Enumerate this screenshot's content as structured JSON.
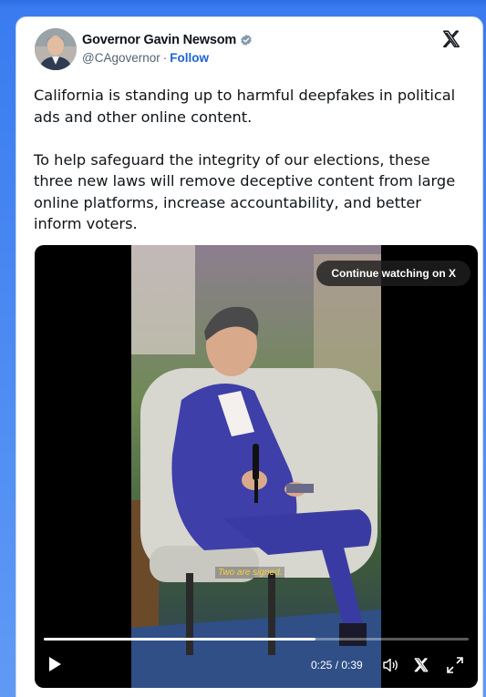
{
  "tweet": {
    "author": {
      "name": "Governor Gavin Newsom",
      "handle": "@CAgovernor",
      "separator": "·",
      "follow_label": "Follow",
      "verified_color": "#829aab"
    },
    "platform_icon": "x-logo-icon",
    "text": {
      "paragraph1": "California is standing up to harmful deepfakes in political ads and other online content.",
      "paragraph2": "To help safeguard the integrity of our elections, these three new laws will remove deceptive content from large online platforms, increase accountability, and better inform voters."
    },
    "video": {
      "continue_label": "Continue watching on X",
      "subtitle": "Two are signed.",
      "time_display": "0:25 / 0:39",
      "progress_fraction": 0.64,
      "icons": [
        "play-icon",
        "volume-icon",
        "x-logo-icon",
        "fullscreen-icon"
      ]
    }
  },
  "colors": {
    "page_background": "#3a7cf0",
    "link": "#1d64d6",
    "text": "#0f1419",
    "muted": "#536471"
  }
}
